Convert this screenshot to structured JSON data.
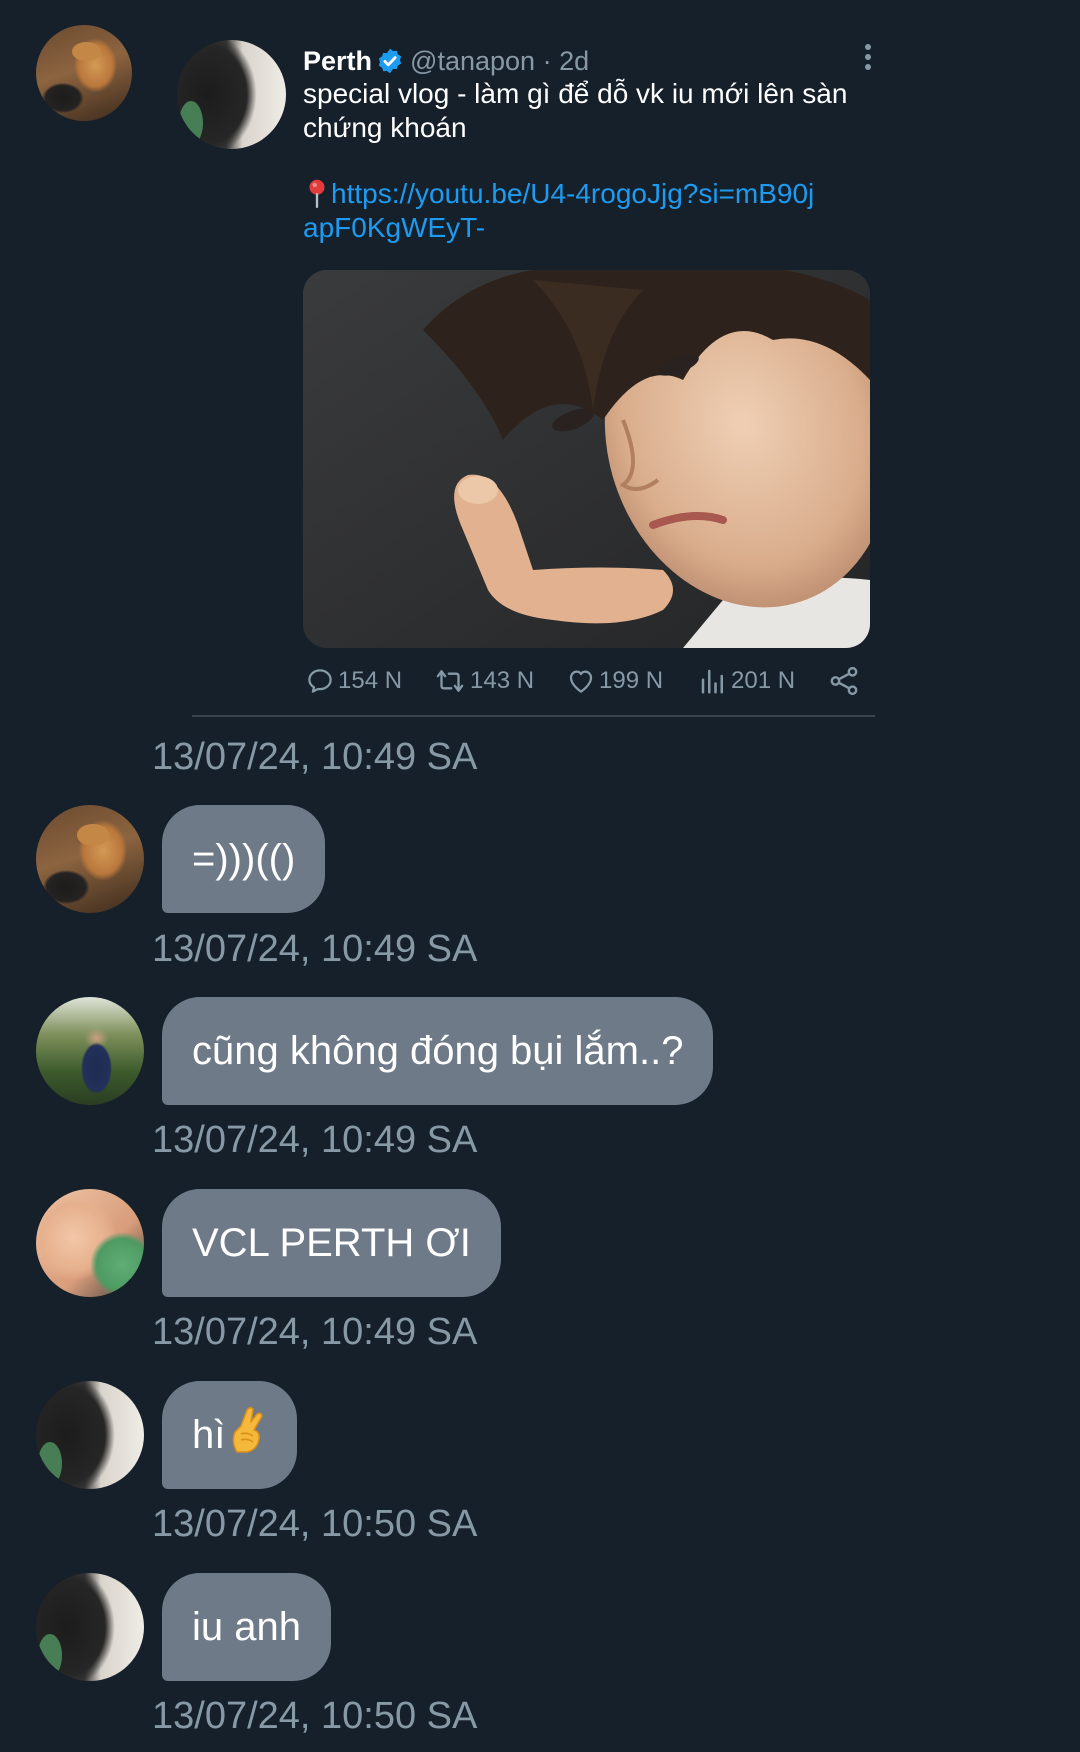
{
  "tweet": {
    "name": "Perth",
    "handle": "@tanapon",
    "separator": "·",
    "time": "2d",
    "text": "special vlog - làm gì để dỗ vk iu mới lên sàn chứng khoán",
    "link": "https://youtu.be/U4-4rogoJjg?si=mB90japF0KgWEyT-",
    "stats": {
      "replies": "154 N",
      "retweets": "143 N",
      "likes": "199 N",
      "views": "201 N"
    }
  },
  "messages": [
    {
      "timestamp": "13/07/24, 10:49 SA"
    },
    {
      "text": "=)))(()",
      "timestamp": "13/07/24, 10:49 SA"
    },
    {
      "text": "cũng không đóng bụi lắm..?",
      "timestamp": "13/07/24, 10:49 SA"
    },
    {
      "text": "VCL PERTH ƠI",
      "timestamp": "13/07/24, 10:49 SA"
    },
    {
      "text": "hì",
      "emoji": "crossed-fingers-emoji",
      "timestamp": "13/07/24, 10:50 SA"
    },
    {
      "text": "iu anh",
      "timestamp": "13/07/24, 10:50 SA"
    }
  ],
  "icons": {
    "verified": "verified-badge-icon",
    "pin": "round-pushpin-icon",
    "reply": "reply-icon",
    "retweet": "retweet-icon",
    "like": "heart-icon",
    "views": "views-bar-chart-icon",
    "share": "share-icon",
    "more": "more-vertical-icon"
  },
  "colors": {
    "background": "#15202b",
    "bubble": "#6e7a88",
    "link": "#1d9bf0",
    "muted": "#8899a6",
    "verified": "#1d9bf0"
  }
}
